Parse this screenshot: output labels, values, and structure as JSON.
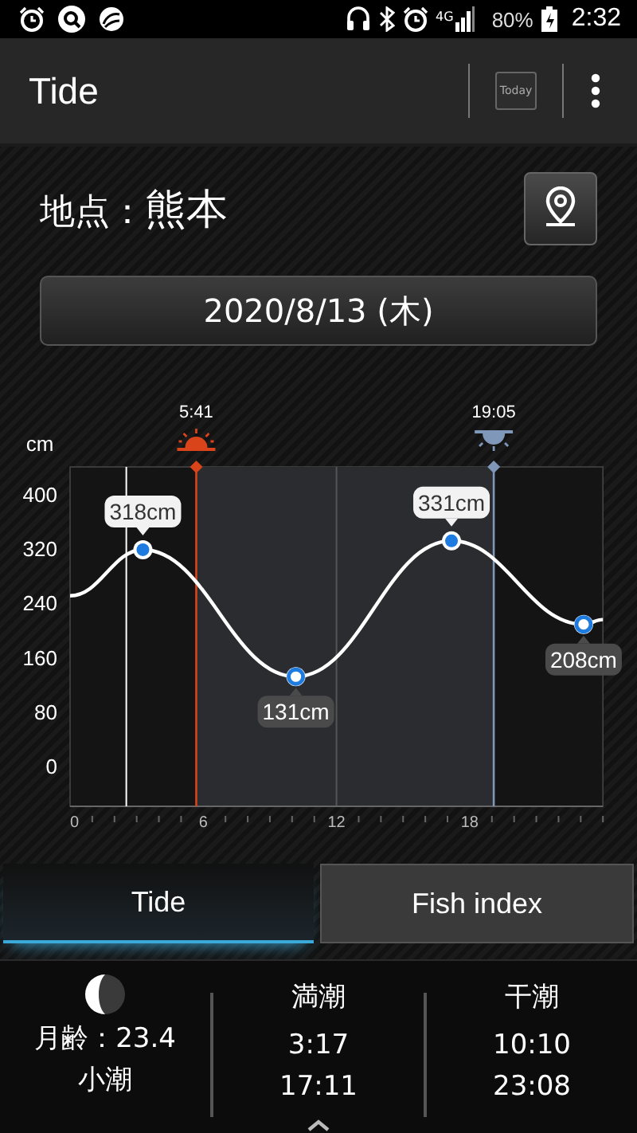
{
  "status_bar": {
    "network": "4G",
    "battery": "80%",
    "time": "2:32"
  },
  "app_bar": {
    "title": "Tide",
    "today_button": "Today"
  },
  "location": {
    "label": "地点：",
    "name": "熊本"
  },
  "date": "2020/8/13 (木)",
  "chart": {
    "chart_data": {
      "type": "line",
      "ylabel": "cm",
      "x": [
        0,
        3.28,
        10.17,
        17.18,
        23.13,
        24
      ],
      "series": [
        {
          "color": "#ffffff",
          "values": [
            250,
            318,
            131,
            331,
            208,
            215
          ]
        }
      ],
      "xlim": [
        0,
        24
      ],
      "ylim": [
        -60,
        440
      ],
      "xticks": [
        0,
        6,
        12,
        18
      ],
      "yticks": [
        0,
        80,
        160,
        240,
        320,
        400
      ],
      "annotations": [
        {
          "x": 3.28,
          "y": 318,
          "text": "318cm"
        },
        {
          "x": 10.17,
          "y": 131,
          "text": "131cm"
        },
        {
          "x": 17.18,
          "y": 331,
          "text": "331cm"
        },
        {
          "x": 23.13,
          "y": 208,
          "text": "208cm"
        }
      ],
      "ref_lines": [
        {
          "axis": "x",
          "value": 5.6833,
          "color": "#d9441a"
        },
        {
          "axis": "x",
          "value": 19.0833,
          "color": "#7f97b8"
        },
        {
          "axis": "x",
          "value": 2.5333,
          "color": "#ffffff"
        }
      ],
      "bands": [
        {
          "axis": "x",
          "from": 5.6833,
          "to": 19.0833,
          "color": "#2a2c30"
        }
      ]
    },
    "sun_times": [
      "5:41",
      "19:05"
    ]
  },
  "tabs": [
    {
      "label": "Tide",
      "selected": true
    },
    {
      "label": "Fish index",
      "selected": false
    }
  ],
  "summary": {
    "moon": {
      "age": "月齢：23.4",
      "tide_type": "小潮"
    },
    "high_tide": {
      "title": "満潮",
      "times": [
        "3:17",
        "17:11"
      ]
    },
    "low_tide": {
      "title": "干潮",
      "times": [
        "10:10",
        "23:08"
      ]
    }
  }
}
